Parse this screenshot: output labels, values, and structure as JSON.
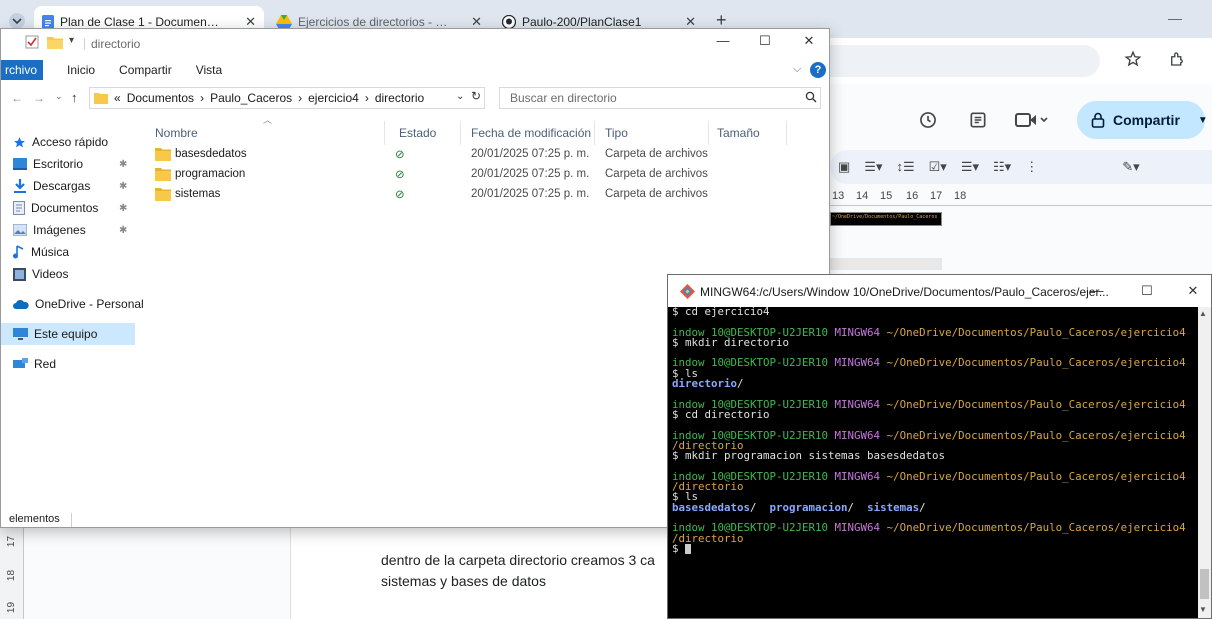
{
  "browser": {
    "tabs": [
      {
        "title": "Plan de Clase 1 - Documentos de Google",
        "icon": "docs-icon"
      },
      {
        "title": "Ejercicios de directorios - Google Drive",
        "icon": "drive-icon"
      },
      {
        "title": "Paulo-200/PlanClase1",
        "icon": "github-icon"
      }
    ],
    "new_tab": "+",
    "minimize": "—",
    "close_x": "✕"
  },
  "docs": {
    "share_label": "Compartir",
    "ruler_ticks": [
      "13",
      "14",
      "15",
      "16",
      "17",
      "18"
    ],
    "left_ruler": [
      "17",
      "18",
      "19"
    ],
    "thumbnail_text": "~/OneDrive/Documentos/Paulo_Caceros",
    "body_line_1": "dentro de la carpeta directorio creamos 3 ca",
    "body_line_2": "sistemas y bases de datos"
  },
  "explorer": {
    "title": "directorio",
    "ribbon": [
      "rchivo",
      "Inicio",
      "Compartir",
      "Vista"
    ],
    "path": [
      "«",
      "Documentos",
      "›",
      "Paulo_Caceros",
      "›",
      "ejercicio4",
      "›",
      "directorio"
    ],
    "search_placeholder": "Buscar en directorio",
    "nav_items": [
      {
        "label": "Acceso rápido",
        "icon": "star-icon",
        "pinned": false
      },
      {
        "label": "Escritorio",
        "icon": "desktop-icon",
        "pinned": true
      },
      {
        "label": "Descargas",
        "icon": "download-icon",
        "pinned": true
      },
      {
        "label": "Documentos",
        "icon": "documents-icon",
        "pinned": true
      },
      {
        "label": "Imágenes",
        "icon": "pictures-icon",
        "pinned": true
      },
      {
        "label": "Música",
        "icon": "music-icon",
        "pinned": false
      },
      {
        "label": "Videos",
        "icon": "videos-icon",
        "pinned": false
      },
      {
        "label": "OneDrive - Personal",
        "icon": "onedrive-icon",
        "pinned": false
      },
      {
        "label": "Este equipo",
        "icon": "computer-icon",
        "pinned": false
      },
      {
        "label": "Red",
        "icon": "network-icon",
        "pinned": false
      }
    ],
    "columns": [
      "Nombre",
      "Estado",
      "Fecha de modificación",
      "Tipo",
      "Tamaño"
    ],
    "files": [
      {
        "name": "basesdedatos",
        "status": "⊘",
        "date": "20/01/2025 07:25 p. m.",
        "type": "Carpeta de archivos"
      },
      {
        "name": "programacion",
        "status": "⊘",
        "date": "20/01/2025 07:25 p. m.",
        "type": "Carpeta de archivos"
      },
      {
        "name": "sistemas",
        "status": "⊘",
        "date": "20/01/2025 07:25 p. m.",
        "type": "Carpeta de archivos"
      }
    ],
    "status_text": "elementos",
    "window_controls": {
      "minimize": "—",
      "maximize": "☐",
      "close": "✕"
    }
  },
  "terminal": {
    "title": "MINGW64:/c/Users/Window 10/OneDrive/Documentos/Paulo_Caceros/ejer...",
    "prompt_user": "indow 10@DESKTOP-U2JER10",
    "prompt_env": "MINGW64",
    "prompt_path": "~/OneDrive/Documentos/Paulo_Caceros/ejercicio4",
    "sub_path": "/directorio",
    "lines": {
      "l1": "$ cd ejercicio4",
      "l2": "$ mkdir directorio",
      "l3": "$ ls",
      "l4": "directorio",
      "l5": "$ cd directorio",
      "l6": "$ mkdir programacion sistemas basesdedatos",
      "l7": "$ ls",
      "l8a": "basesdedatos",
      "l8b": "programacion",
      "l8c": "sistemas",
      "l9": "$ "
    },
    "window_controls": {
      "minimize": "—",
      "maximize": "☐",
      "close": "✕"
    }
  }
}
